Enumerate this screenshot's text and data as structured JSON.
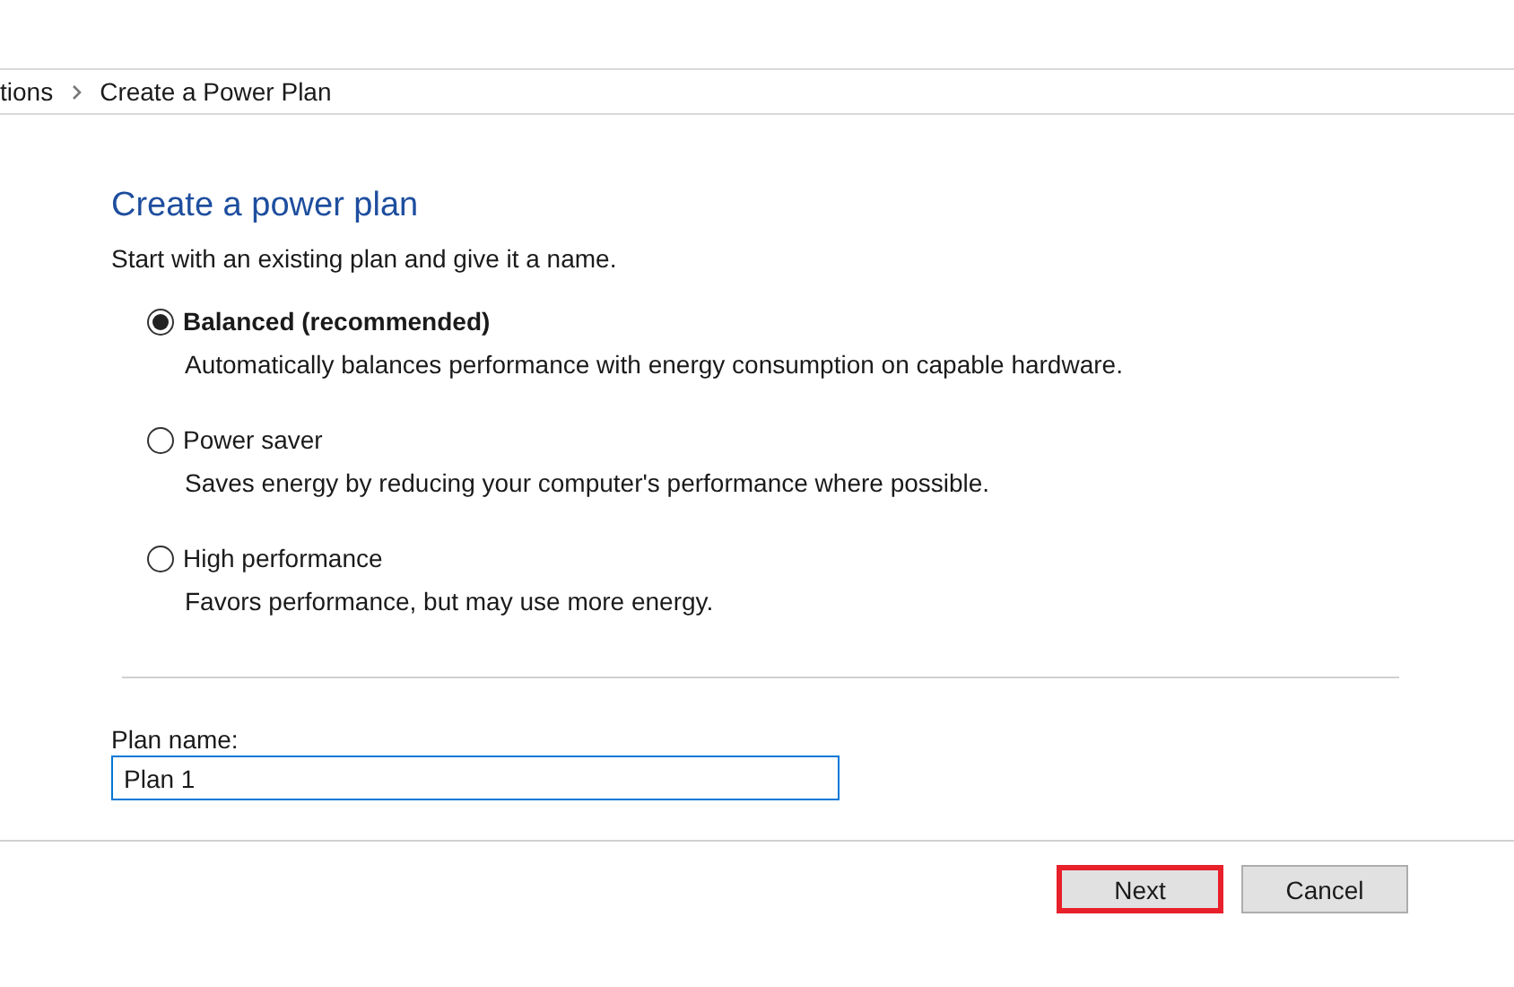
{
  "breadcrumb": [
    {
      "label": "tions"
    },
    {
      "label": "Create a Power Plan"
    }
  ],
  "heading": "Create a power plan",
  "intro": "Start with an existing plan and give it a name.",
  "plans": [
    {
      "label": "Balanced (recommended)",
      "description": "Automatically balances performance with energy consumption on capable hardware.",
      "selected": true
    },
    {
      "label": "Power saver",
      "description": "Saves energy by reducing your computer's performance where possible.",
      "selected": false
    },
    {
      "label": "High performance",
      "description": "Favors performance, but may use more energy.",
      "selected": false
    }
  ],
  "plan_name": {
    "label": "Plan name:",
    "value": "Plan 1",
    "focused": true
  },
  "buttons": [
    {
      "label": "Next",
      "highlighted": true
    },
    {
      "label": "Cancel",
      "highlighted": false
    }
  ]
}
